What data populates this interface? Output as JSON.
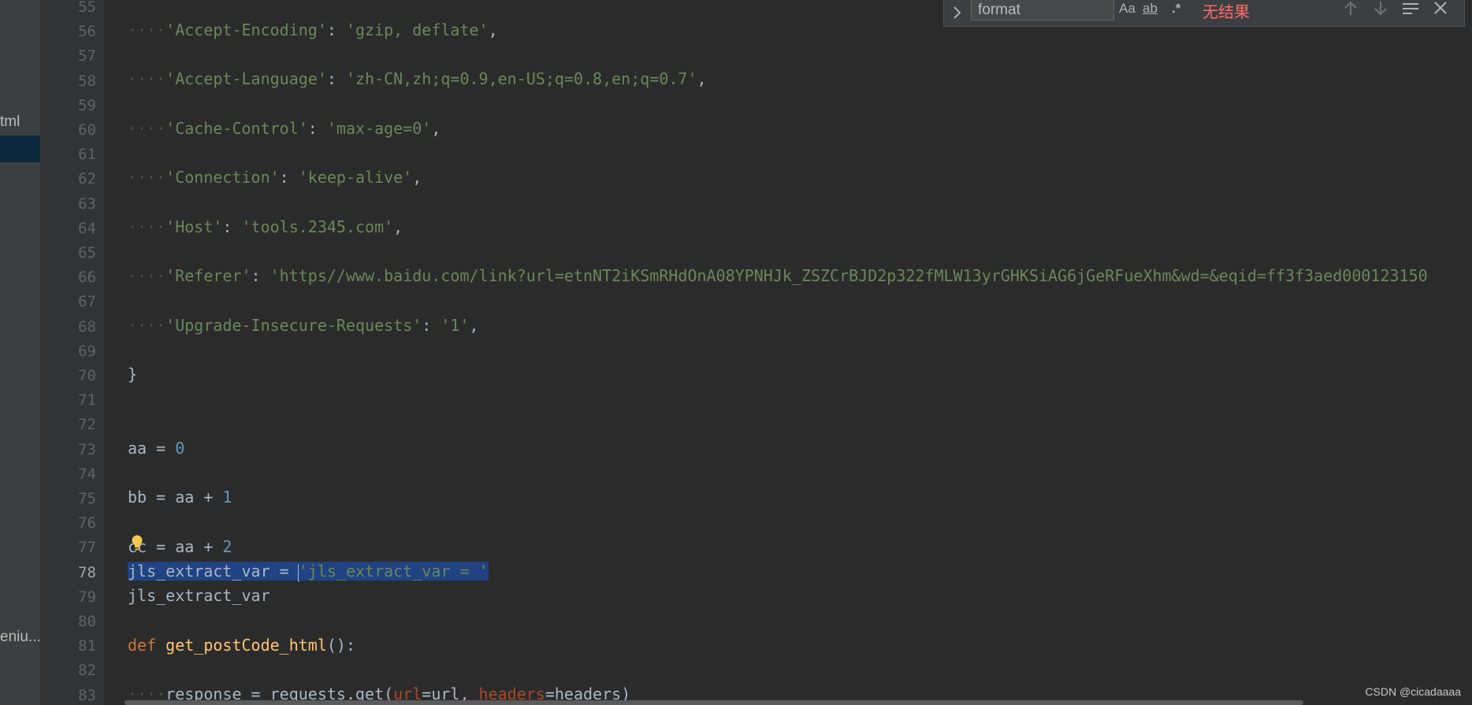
{
  "sidebar": {
    "items": [
      {
        "label": "tml"
      },
      {
        "label": "eniu..."
      }
    ]
  },
  "find_bar": {
    "query": "format",
    "options": [
      "Aa",
      "ab",
      ".*"
    ],
    "status": "无结果"
  },
  "gutter": {
    "lines": [
      "55",
      "56",
      "57",
      "58",
      "59",
      "60",
      "61",
      "62",
      "63",
      "64",
      "65",
      "66",
      "67",
      "68",
      "69",
      "70",
      "71",
      "72",
      "73",
      "74",
      "75",
      "76",
      "77",
      "78",
      "79",
      "80",
      "81",
      "82",
      "83"
    ],
    "current": "78"
  },
  "code": {
    "l56": {
      "indent": "····",
      "key": "'Accept-Encoding'",
      "sep": ": ",
      "val": "'gzip, deflate'",
      "end": ","
    },
    "l58": {
      "indent": "····",
      "key": "'Accept-Language'",
      "sep": ": ",
      "val": "'zh-CN,zh;q=0.9,en-US;q=0.8,en;q=0.7'",
      "end": ","
    },
    "l60": {
      "indent": "····",
      "key": "'Cache-Control'",
      "sep": ": ",
      "val": "'max-age=0'",
      "end": ","
    },
    "l62": {
      "indent": "····",
      "key": "'Connection'",
      "sep": ": ",
      "val": "'keep-alive'",
      "end": ","
    },
    "l64": {
      "indent": "····",
      "key": "'Host'",
      "sep": ": ",
      "val": "'tools.2345.com'",
      "end": ","
    },
    "l66": {
      "indent": "····",
      "key": "'Referer'",
      "sep": ": ",
      "val": "'https//www.baidu.com/link?url=etnNT2iKSmRHdOnA08YPNHJk_ZSZCrBJD2p322fMLW13yrGHKSiAG6jGeRFueXhm&wd=&eqid=ff3f3aed000123150"
    },
    "l68": {
      "indent": "····",
      "key": "'Upgrade-Insecure-Requests'",
      "sep": ": ",
      "val": "'1'",
      "end": ","
    },
    "l70": {
      "text": "}"
    },
    "l73": {
      "lhs": "aa = ",
      "num": "0"
    },
    "l75": {
      "lhs": "bb = aa + ",
      "num": "1"
    },
    "l77": {
      "lhs": "cc = aa + ",
      "num": "2"
    },
    "l78": {
      "sel_text": "jls_extract_var = ",
      "sel_str": "'jls_extract_var = '"
    },
    "l79": {
      "text": "jls_extract_var"
    },
    "l81": {
      "kw": "def",
      "fn": "get_postCode_html",
      "rest": "():"
    },
    "l83": {
      "indent": "····",
      "a": "response = requests.get(",
      "p1": "url",
      "b": "=url, ",
      "p2": "headers",
      "c": "=headers)"
    }
  },
  "watermark": "CSDN @cicadaaaa",
  "colors": {
    "editor_bg": "#2b2b2b",
    "gutter_bg": "#313335",
    "string": "#6a8759",
    "number": "#6897bb",
    "keyword": "#cc7832",
    "function": "#ffc66d",
    "param": "#aa4926",
    "selection": "#214283",
    "no_results": "#ff6b68"
  }
}
